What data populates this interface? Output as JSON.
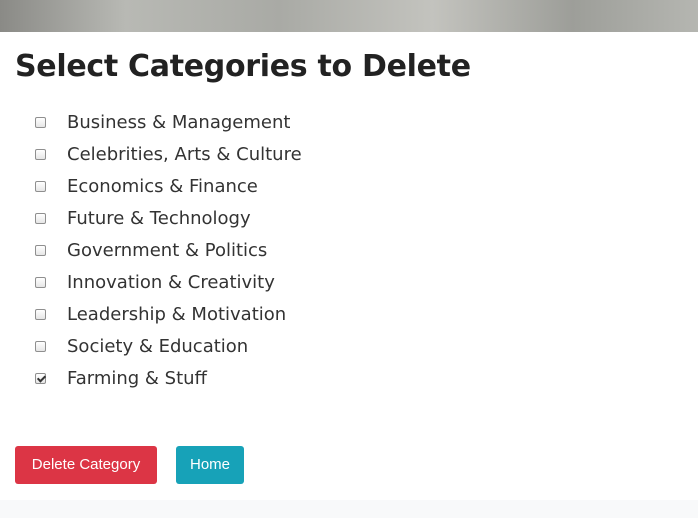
{
  "page": {
    "title": "Select Categories to Delete"
  },
  "categories": [
    {
      "label": "Business & Management",
      "checked": false
    },
    {
      "label": "Celebrities, Arts & Culture",
      "checked": false
    },
    {
      "label": "Economics & Finance",
      "checked": false
    },
    {
      "label": "Future & Technology",
      "checked": false
    },
    {
      "label": "Government & Politics",
      "checked": false
    },
    {
      "label": "Innovation & Creativity",
      "checked": false
    },
    {
      "label": "Leadership & Motivation",
      "checked": false
    },
    {
      "label": "Society & Education",
      "checked": false
    },
    {
      "label": "Farming & Stuff",
      "checked": true
    }
  ],
  "actions": {
    "delete_label": "Delete Category",
    "home_label": "Home"
  },
  "colors": {
    "danger": "#dc3545",
    "info": "#17a2b8"
  }
}
